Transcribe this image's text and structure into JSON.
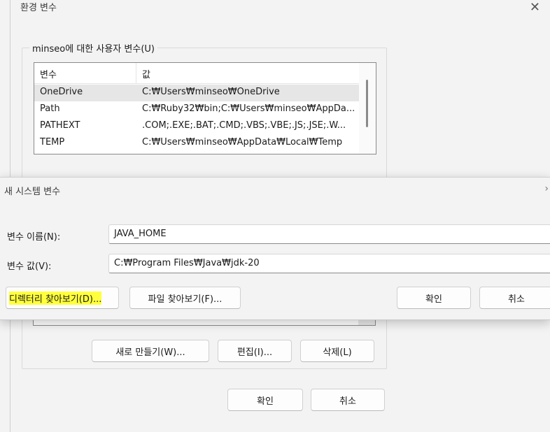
{
  "env_dialog": {
    "title": "환경 변수",
    "close_glyph": "✕",
    "user_group_label": "minseo에 대한 사용자 변수(U)",
    "columns": [
      "변수",
      "값"
    ],
    "rows": [
      {
        "name": "OneDrive",
        "value": "C:₩Users₩minseo₩OneDrive",
        "selected": true
      },
      {
        "name": "Path",
        "value": "C:₩Ruby32₩bin;C:₩Users₩minseo₩AppDa...",
        "selected": false
      },
      {
        "name": "PATHEXT",
        "value": ".COM;.EXE;.BAT;.CMD;.VBS;.VBE;.JS;.JSE;.W...",
        "selected": false
      },
      {
        "name": "TEMP",
        "value": "C:₩Users₩minseo₩AppData₩Local₩Temp",
        "selected": false
      }
    ],
    "system_buttons": {
      "new_label": "새로 만들기(W)...",
      "edit_label": "편집(I)...",
      "delete_label": "삭제(L)"
    },
    "ok_label": "확인",
    "cancel_label": "취소"
  },
  "new_var_dialog": {
    "title": "새 시스템 변수",
    "close_glyph": "›",
    "name_label": "변수 이름(N):",
    "name_value": "JAVA_HOME",
    "value_label": "변수 값(V):",
    "value_value": "C:₩Program Files₩Java₩jdk-20",
    "browse_dir_label": "디렉터리 찾아보기(D)...",
    "browse_file_label": "파일 찾아보기(F)...",
    "ok_label": "확인",
    "cancel_label": "취소"
  },
  "colors": {
    "highlight": "#ffff3d",
    "selected_row": "#e6e6e6"
  }
}
